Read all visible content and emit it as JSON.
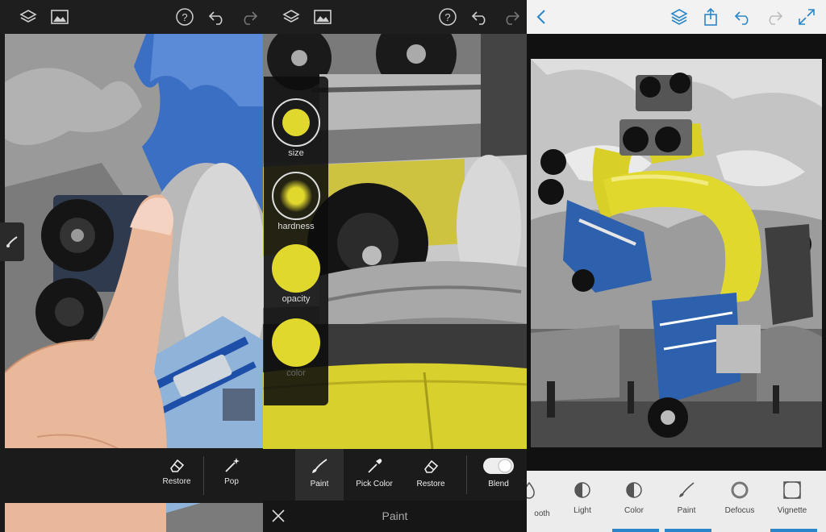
{
  "panel_left": {
    "tools": [
      {
        "label": "Restore",
        "icon": "eraser-icon"
      },
      {
        "label": "Pop",
        "icon": "magic-wand-icon"
      }
    ]
  },
  "panel_middle": {
    "options": [
      {
        "label": "size"
      },
      {
        "label": "hardness"
      },
      {
        "label": "opacity"
      },
      {
        "label": "color"
      }
    ],
    "tools": [
      {
        "label": "Paint",
        "icon": "brush-icon",
        "active": true
      },
      {
        "label": "Pick Color",
        "icon": "eyedropper-icon"
      },
      {
        "label": "Restore",
        "icon": "eraser-icon"
      },
      {
        "label": "Blend",
        "icon": "toggle-icon"
      }
    ],
    "footer_title": "Paint",
    "paint_color": "#e1d82e"
  },
  "panel_right": {
    "tools": [
      {
        "label": "ooth",
        "icon": "droplet-icon"
      },
      {
        "label": "Light",
        "icon": "half-circle-icon"
      },
      {
        "label": "Color",
        "icon": "half-circle-icon"
      },
      {
        "label": "Paint",
        "icon": "brush-icon"
      },
      {
        "label": "Defocus",
        "icon": "ring-icon"
      },
      {
        "label": "Vignette",
        "icon": "vignette-icon"
      }
    ],
    "accent_color": "#2a86c8"
  }
}
